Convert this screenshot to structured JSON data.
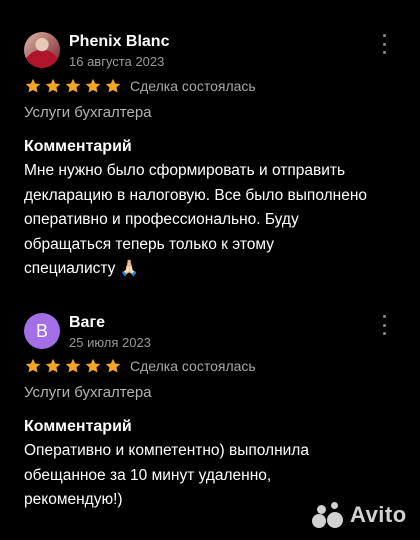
{
  "reviews": [
    {
      "author": "Phenix Blanc",
      "date": "16 августа 2023",
      "rating": 5,
      "deal_status": "Сделка состоялась",
      "service": "Услуги бухгалтера",
      "comment_title": "Комментарий",
      "comment_lines": [
        "Мне нужно было сформировать и отправить",
        "декларацию в налоговую. Все было выполнено",
        "оперативно и профессионально. Буду",
        "обращаться теперь только к этому",
        "специалисту 🙏🏻"
      ]
    },
    {
      "author": "Ваге",
      "avatar_letter": "В",
      "date": "25 июля 2023",
      "rating": 5,
      "deal_status": "Сделка состоялась",
      "service": "Услуги бухгалтера",
      "comment_title": "Комментарий",
      "comment_lines": [
        "Оперативно и компетентно) выполнила",
        "обещанное за 10 минут удаленно,",
        "рекомендую!)"
      ]
    }
  ],
  "watermark": {
    "text": "Avito"
  },
  "icons": {
    "star": "star-icon",
    "menu": "more-vertical-icon"
  },
  "colors": {
    "star": "#f5a623",
    "avatar_b": "#a36ee6",
    "background": "#000000"
  }
}
